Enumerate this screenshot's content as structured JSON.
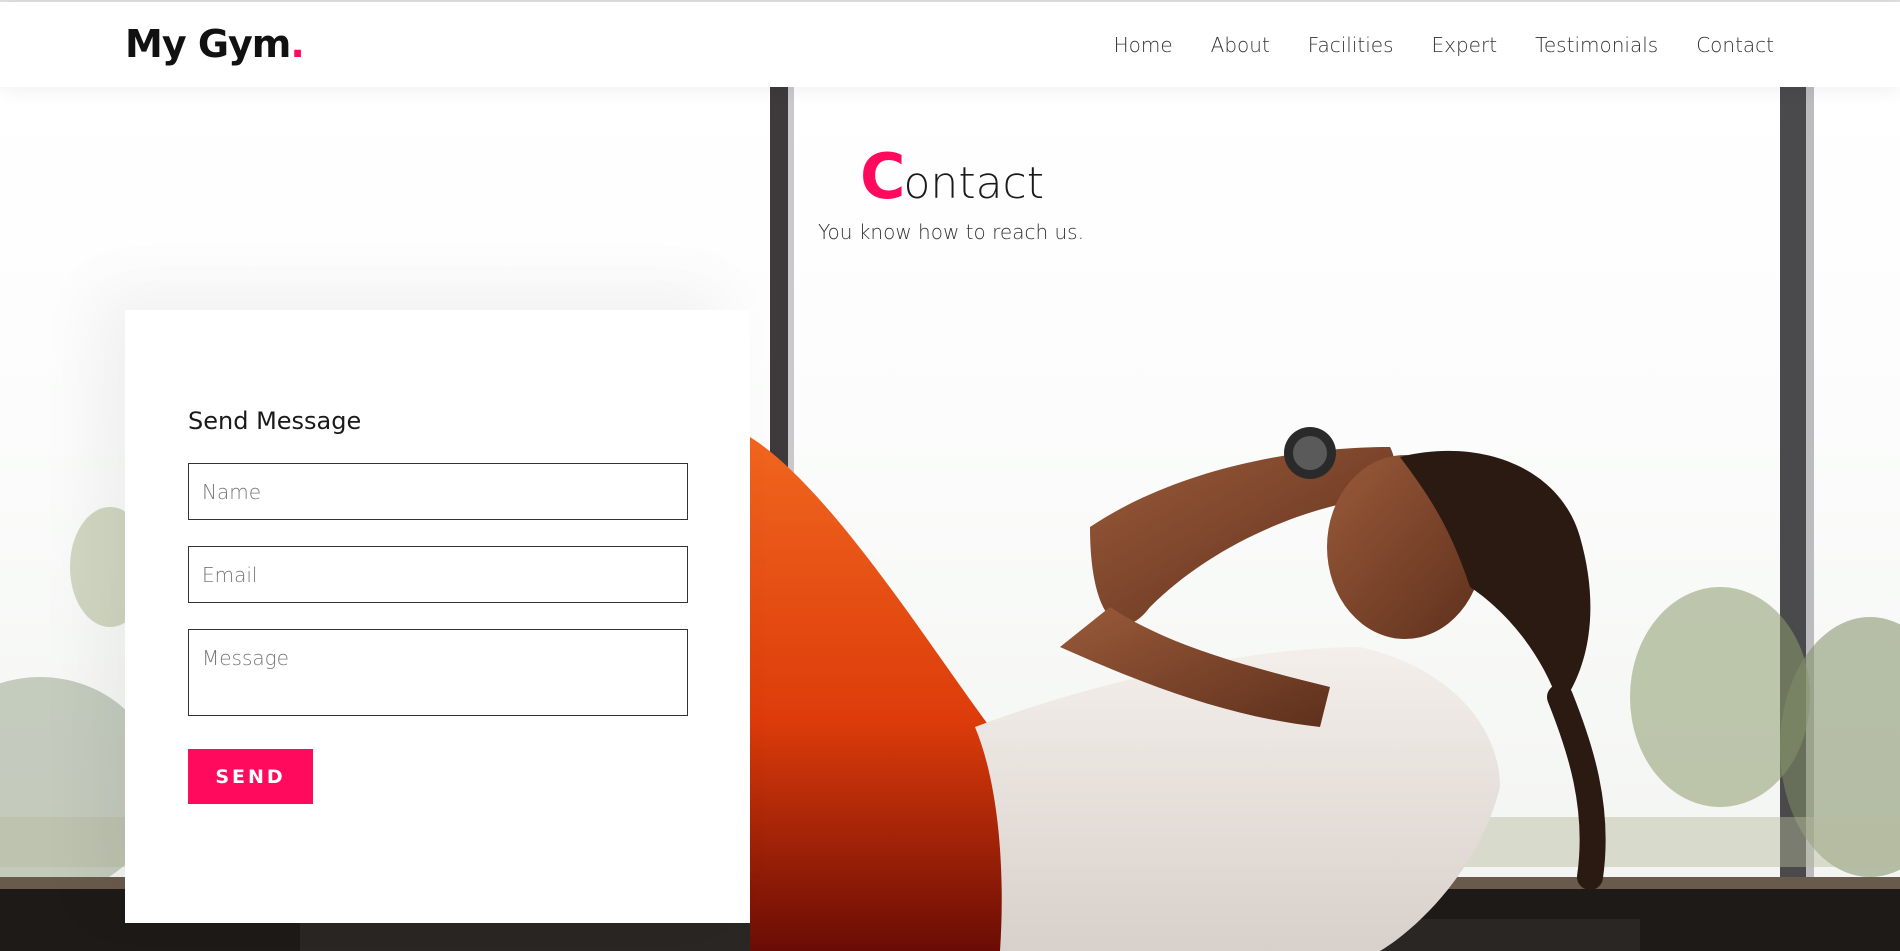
{
  "theme": {
    "accent": "#ff0a5c"
  },
  "header": {
    "logo_text": "My Gym",
    "logo_dot": ".",
    "nav": [
      "Home",
      "About",
      "Facilities",
      "Expert",
      "Testimonials",
      "Contact"
    ]
  },
  "contact": {
    "title_initial": "C",
    "title_rest": "ontact",
    "subtitle": "You know how to reach us."
  },
  "form": {
    "title": "Send Message",
    "name_placeholder": "Name",
    "email_placeholder": "Email",
    "message_placeholder": "Message",
    "send_label": "SEND"
  },
  "background": {
    "icon": "woman-doing-crunches-photo"
  }
}
